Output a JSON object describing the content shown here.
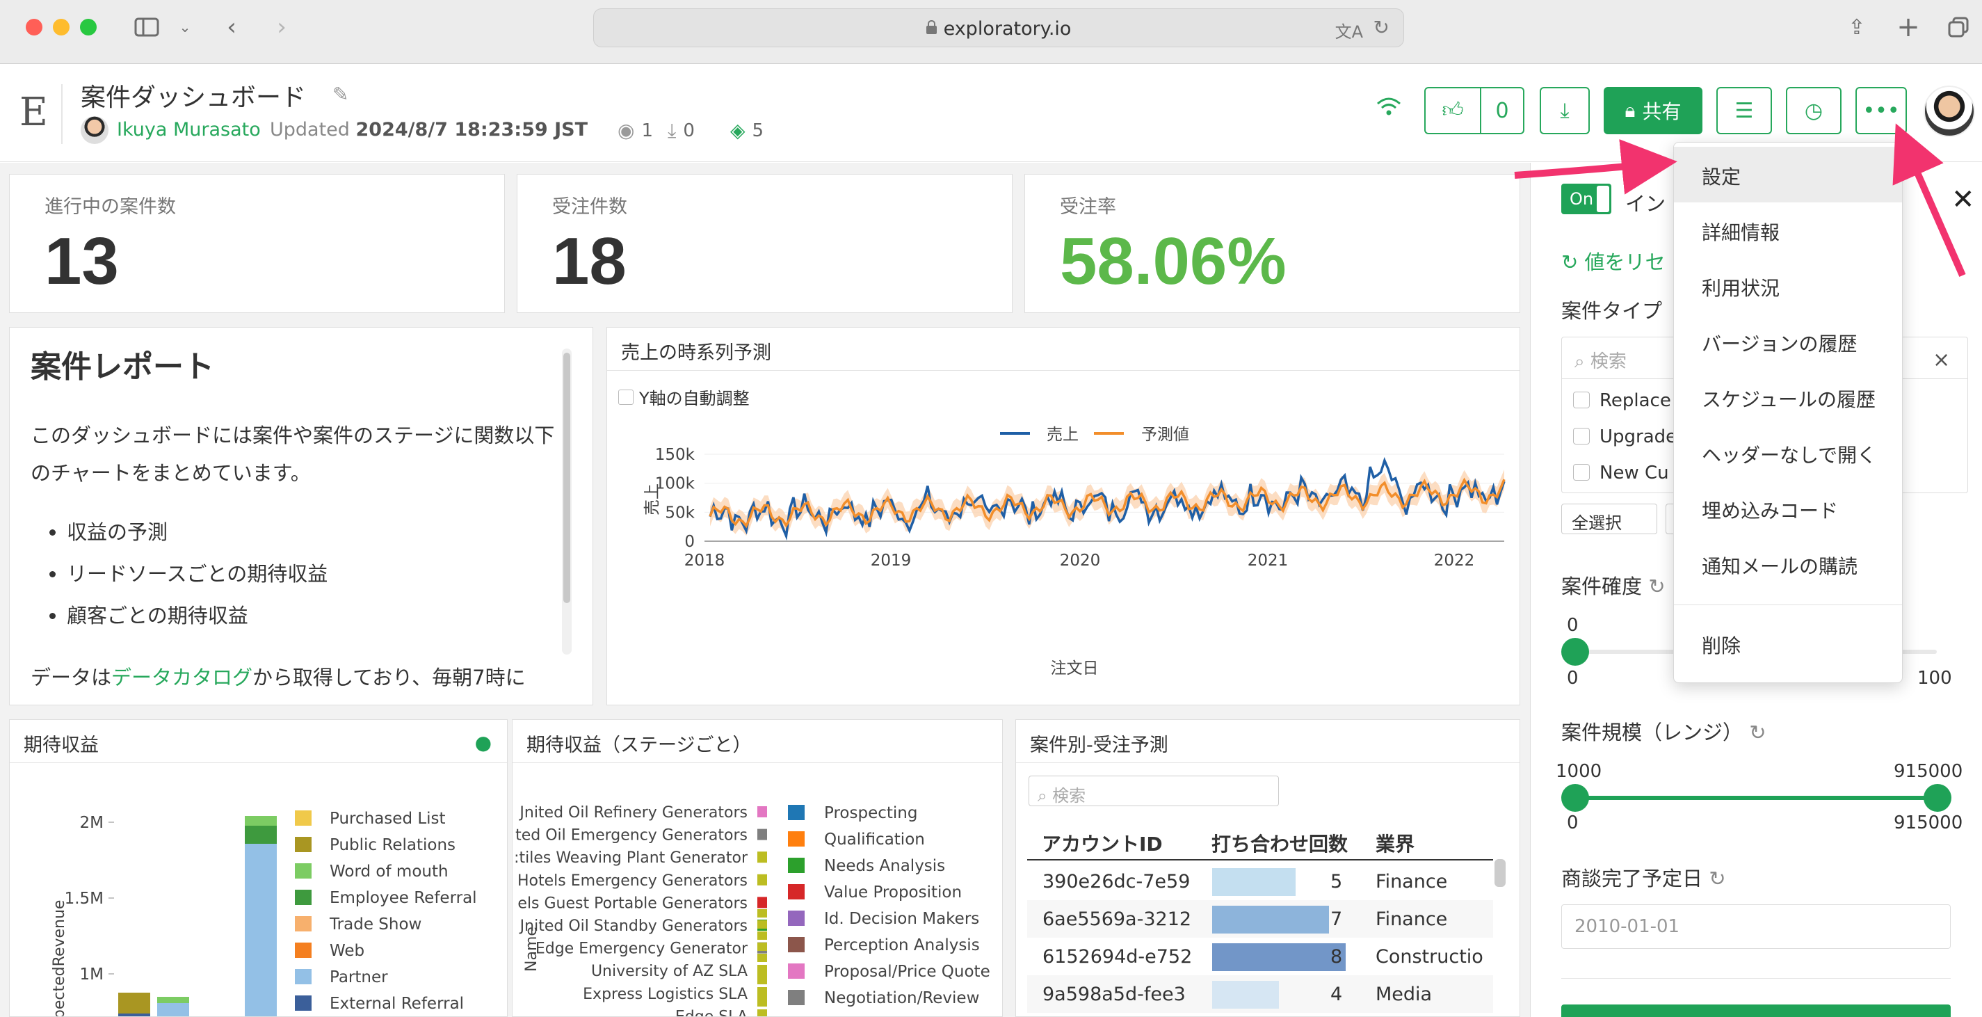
{
  "browser": {
    "url": "exploratory.io"
  },
  "header": {
    "logo": "E",
    "title": "案件ダッシュボード",
    "author": "Ikuya Murasato",
    "updated_prefix": "Updated",
    "updated_value": "2024/8/7 18:23:59 JST",
    "views": "1",
    "downloads": "0",
    "tags": "5",
    "like_count": "0",
    "share_label": "共有"
  },
  "kpis": [
    {
      "label": "進行中の案件数",
      "value": "13"
    },
    {
      "label": "受注件数",
      "value": "18"
    },
    {
      "label": "受注率",
      "value": "58.06%"
    }
  ],
  "report": {
    "heading": "案件レポート",
    "paragraph": "このダッシュボードには案件や案件のステージに関数以下のチャートをまとめています。",
    "bullets": [
      "収益の予測",
      "リードソースごとの期待収益",
      "顧客ごとの期待収益"
    ],
    "foot_prefix": "データは",
    "foot_link": "データカタログ",
    "foot_suffix": "から取得しており、毎朝7時に"
  },
  "forecast": {
    "title": "売上の時系列予測",
    "checkbox_label": "Y軸の自動調整",
    "legend": [
      "売上",
      "予測値"
    ],
    "xlabel": "注文日",
    "ylabel": "売上",
    "yticks": [
      "150k",
      "100k",
      "50k",
      "0"
    ],
    "xticks": [
      "2018",
      "2019",
      "2020",
      "2021",
      "2022"
    ]
  },
  "expected_revenue": {
    "title": "期待収益",
    "ylabel": "ExpectedRevenue",
    "yticks": [
      "2M",
      "1.5M",
      "1M"
    ],
    "legend": [
      "Purchased List",
      "Public Relations",
      "Word of mouth",
      "Employee Referral",
      "Trade Show",
      "Web",
      "Partner",
      "External Referral"
    ],
    "colors": [
      "#f0c94a",
      "#a99622",
      "#7ccc63",
      "#3e9a3e",
      "#f7b06d",
      "#f47f20",
      "#93c0e6",
      "#3b5f9a"
    ]
  },
  "stage_revenue": {
    "title": "期待収益（ステージごと）",
    "ylabel": "Name",
    "names": [
      "Jnited Oil Refinery Generators",
      "ted Oil Emergency Generators",
      ":tiles Weaving Plant Generator",
      "Hotels Emergency Generators",
      "els Guest Portable Generators",
      "Jnited Oil Standby Generators",
      "Edge Emergency Generator",
      "University of AZ SLA",
      "Express Logistics SLA",
      "Edge SLA"
    ],
    "legend": [
      "Prospecting",
      "Qualification",
      "Needs Analysis",
      "Value Proposition",
      "Id. Decision Makers",
      "Perception Analysis",
      "Proposal/Price Quote",
      "Negotiation/Review"
    ],
    "colors": [
      "#1f77b4",
      "#ff7f0e",
      "#2ca02c",
      "#d62728",
      "#9467bd",
      "#8c564b",
      "#e377c2",
      "#7f7f7f"
    ]
  },
  "deal_table": {
    "title": "案件別-受注予測",
    "search_placeholder": "検索",
    "columns": [
      "アカウントID",
      "打ち合わせ回数",
      "業界"
    ],
    "rows": [
      {
        "id": "390e26dc-7e59",
        "meetings": "5",
        "industry": "Finance"
      },
      {
        "id": "6ae5569a-3212",
        "meetings": "7",
        "industry": "Finance"
      },
      {
        "id": "6152694d-e752",
        "meetings": "8",
        "industry": "Constructio"
      },
      {
        "id": "9a598a5d-fee3",
        "meetings": "4",
        "industry": "Media"
      }
    ]
  },
  "right_panel": {
    "toggle": "On",
    "title_partial": "イン",
    "reset_partial": "値をリセ",
    "type_label": "案件タイプ",
    "search_placeholder": "検索",
    "options": [
      "Replace",
      "Upgrade",
      "New Cu"
    ],
    "select_all": "全選択",
    "prob_label": "案件確度",
    "prob_min": "0",
    "prob_scale_min": "0",
    "prob_scale_max": "100",
    "size_label": "案件規模（レンジ）",
    "size_lo": "1000",
    "size_hi": "915000",
    "size_scale_min": "0",
    "size_scale_max": "915000",
    "close_label": "商談完了予定日",
    "date_value": "2010-01-01"
  },
  "menu": {
    "items": [
      "設定",
      "詳細情報",
      "利用状況",
      "バージョンの履歴",
      "スケジュールの履歴",
      "ヘッダーなしで開く",
      "埋め込みコード",
      "通知メールの購読"
    ],
    "delete": "削除"
  }
}
